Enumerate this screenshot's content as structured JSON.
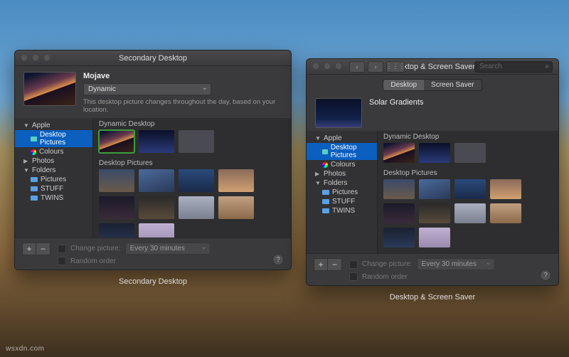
{
  "watermark": "wsxdn.com",
  "left_window": {
    "title": "Secondary Desktop",
    "wallpaper_name": "Mojave",
    "dynamic_select": "Dynamic",
    "description": "This desktop picture changes throughout the day, based on your location.",
    "sidebar": {
      "group_apple": "Apple",
      "item_desktop_pictures": "Desktop Pictures",
      "item_colours": "Colours",
      "group_photos": "Photos",
      "group_folders": "Folders",
      "item_pictures": "Pictures",
      "item_stuff": "STUFF",
      "item_twins": "TWINS"
    },
    "section_dynamic": "Dynamic Desktop",
    "section_pictures": "Desktop Pictures",
    "change_picture_label": "Change picture:",
    "change_picture_value": "Every 30 minutes",
    "random_order_label": "Random order",
    "caption": "Secondary Desktop"
  },
  "right_window": {
    "title": "Desktop & Screen Saver",
    "search_placeholder": "Search",
    "tab_desktop": "Desktop",
    "tab_screensaver": "Screen Saver",
    "wallpaper_name": "Solar Gradients",
    "sidebar": {
      "group_apple": "Apple",
      "item_desktop_pictures": "Desktop Pictures",
      "item_colours": "Colours",
      "group_photos": "Photos",
      "group_folders": "Folders",
      "item_pictures": "Pictures",
      "item_stuff": "STUFF",
      "item_twins": "TWINS"
    },
    "section_dynamic": "Dynamic Desktop",
    "section_pictures": "Desktop Pictures",
    "change_picture_label": "Change picture:",
    "change_picture_value": "Every 30 minutes",
    "random_order_label": "Random order",
    "caption": "Desktop & Screen Saver"
  },
  "colors": {
    "accent": "#0a5fbf",
    "window_bg": "#3a3a3c"
  }
}
